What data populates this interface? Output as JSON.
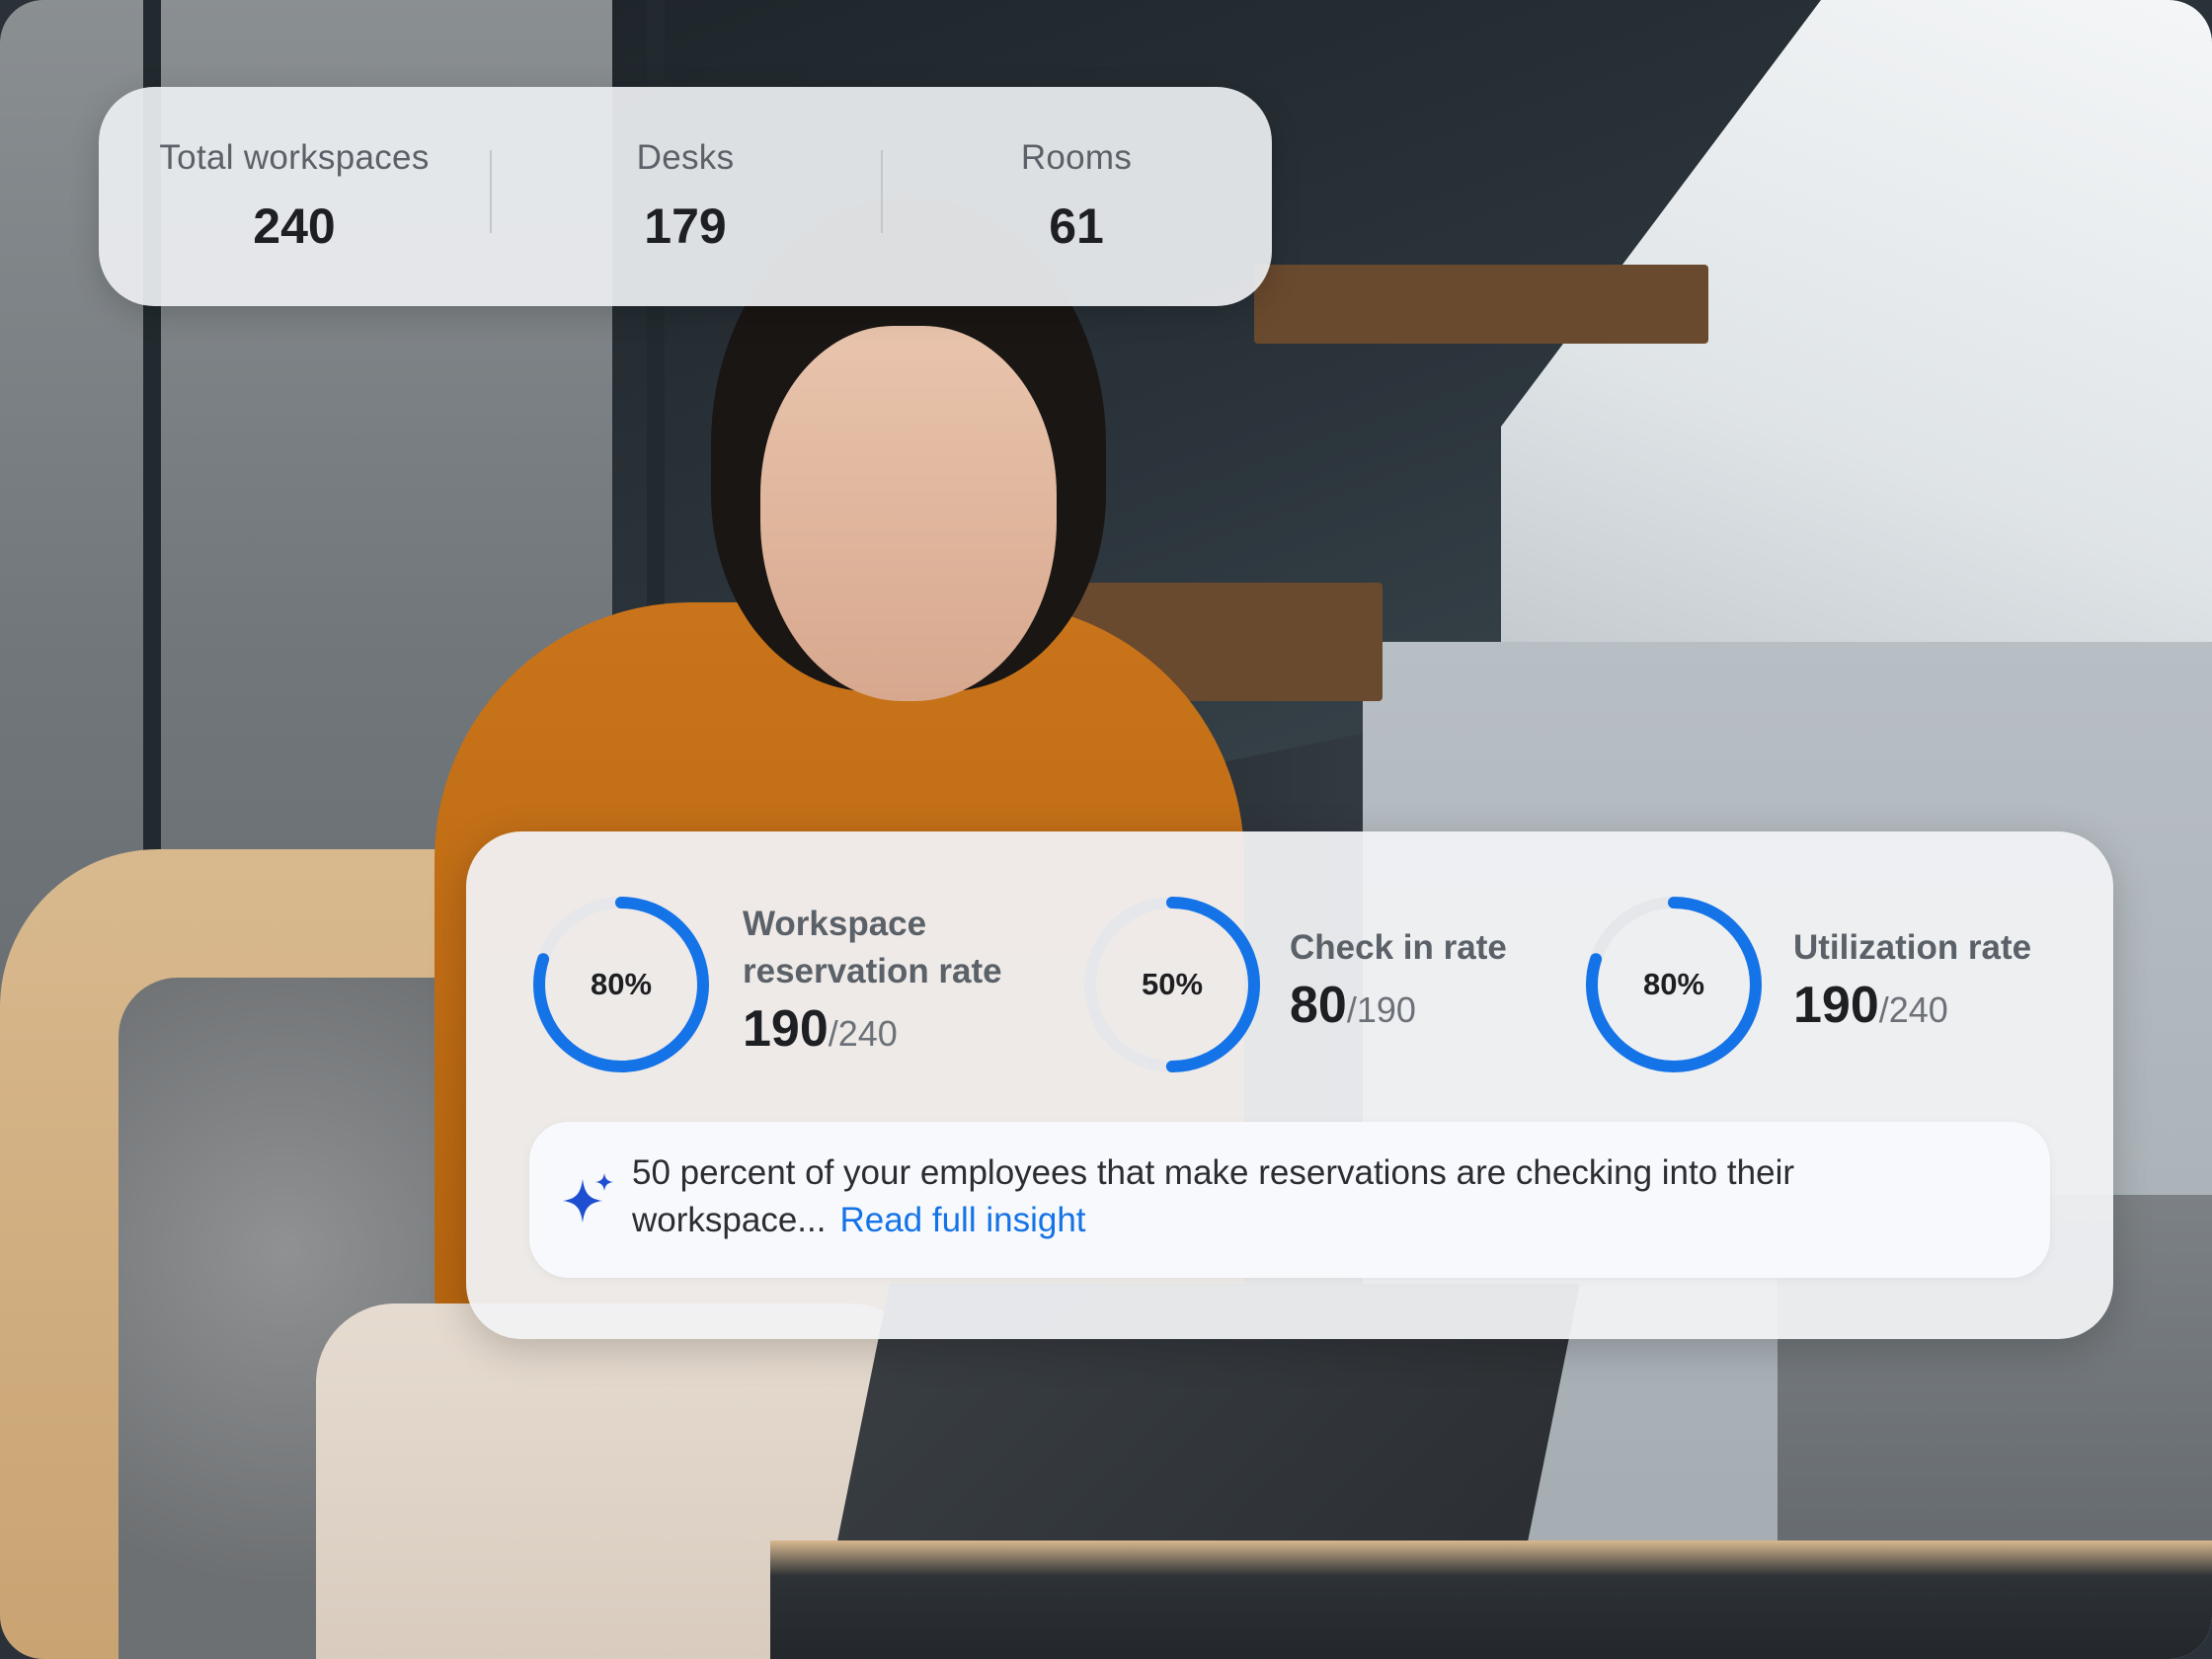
{
  "summary": {
    "total_label": "Total workspaces",
    "total_value": "240",
    "desks_label": "Desks",
    "desks_value": "179",
    "rooms_label": "Rooms",
    "rooms_value": "61"
  },
  "metrics": [
    {
      "percent_text": "80%",
      "percent": 0.8,
      "label_line1": "Workspace",
      "label_line2": "reservation rate",
      "value": "190",
      "total": "/240"
    },
    {
      "percent_text": "50%",
      "percent": 0.5,
      "label_line1": "Check in rate",
      "value": "80",
      "total": "/190"
    },
    {
      "percent_text": "80%",
      "percent": 0.8,
      "label_line1": "Utilization rate",
      "value": "190",
      "total": "/240"
    }
  ],
  "insight": {
    "icon": "sparkle-icon",
    "text": "50 percent of your employees that make reservations are checking into their workspace...",
    "link": "Read full insight"
  },
  "colors": {
    "accent": "#1573e8",
    "ring_track": "#e6e7ea",
    "sparkle": "#1f4fd1"
  }
}
